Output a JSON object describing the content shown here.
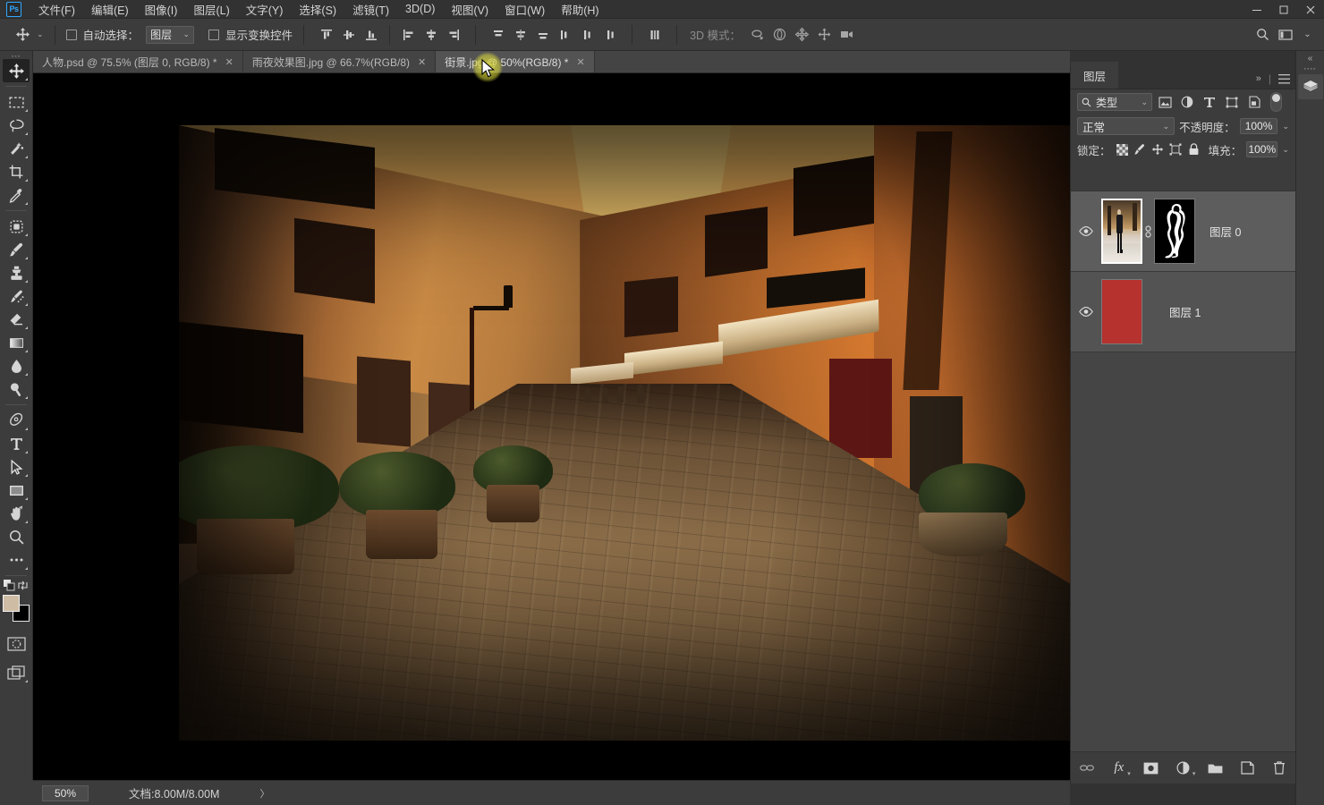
{
  "app": {
    "name": "Photoshop",
    "logo_text": "Ps"
  },
  "menubar": {
    "items": [
      {
        "label": "文件(F)",
        "name": "menu-file"
      },
      {
        "label": "编辑(E)",
        "name": "menu-edit"
      },
      {
        "label": "图像(I)",
        "name": "menu-image"
      },
      {
        "label": "图层(L)",
        "name": "menu-layer"
      },
      {
        "label": "文字(Y)",
        "name": "menu-type"
      },
      {
        "label": "选择(S)",
        "name": "menu-select"
      },
      {
        "label": "滤镜(T)",
        "name": "menu-filter"
      },
      {
        "label": "3D(D)",
        "name": "menu-3d"
      },
      {
        "label": "视图(V)",
        "name": "menu-view"
      },
      {
        "label": "窗口(W)",
        "name": "menu-window"
      },
      {
        "label": "帮助(H)",
        "name": "menu-help"
      }
    ],
    "window_controls": {
      "minimize": "—",
      "maximize": "❐",
      "close": "✕"
    }
  },
  "options_bar": {
    "tool_icon": "move-tool-icon",
    "auto_select_label": "自动选择：",
    "auto_select_checked": false,
    "layer_dropdown_value": "图层",
    "show_transform_label": "显示变换控件",
    "show_transform_checked": false,
    "threed_mode_label": "3D 模式：",
    "align_icons": [
      "align-top-edges-icon",
      "align-vertical-centers-icon",
      "align-bottom-edges-icon",
      "align-left-edges-icon",
      "align-horizontal-centers-icon",
      "align-right-edges-icon"
    ],
    "distribute_icons": [
      "distribute-top-edges-icon",
      "distribute-vertical-centers-icon",
      "distribute-bottom-edges-icon",
      "distribute-left-edges-icon",
      "distribute-horizontal-centers-icon",
      "distribute-right-edges-icon"
    ],
    "extra_icons": [
      "distribute-spacing-icon"
    ],
    "threed_icons": [
      "3d-orbit-icon",
      "3d-roll-icon",
      "3d-pan-icon",
      "3d-slide-icon",
      "3d-camera-icon"
    ],
    "right_icons": [
      "search-icon",
      "workspace-icon",
      "chevron-down-icon"
    ]
  },
  "tabs": [
    {
      "label": "人物.psd @ 75.5% (图层 0, RGB/8) *",
      "active": false,
      "close": "✕"
    },
    {
      "label": "雨夜效果图.jpg @ 66.7%(RGB/8)",
      "active": false,
      "close": "✕"
    },
    {
      "label": "街景.jpg @ 50%(RGB/8) *",
      "active": true,
      "close": "✕"
    }
  ],
  "toolbar": {
    "tools": [
      {
        "name": "move-tool",
        "icon": "move-icon",
        "active": true,
        "submenu": true
      },
      {
        "name": "rectangular-marquee-tool",
        "icon": "marquee-icon",
        "active": false,
        "submenu": true
      },
      {
        "name": "lasso-tool",
        "icon": "lasso-icon",
        "active": false,
        "submenu": true
      },
      {
        "name": "quick-selection-tool",
        "icon": "magic-wand-icon",
        "active": false,
        "submenu": true
      },
      {
        "name": "crop-tool",
        "icon": "crop-icon",
        "active": false,
        "submenu": true
      },
      {
        "name": "eyedropper-tool",
        "icon": "eyedropper-icon",
        "active": false,
        "submenu": true
      },
      {
        "name": "spot-healing-tool",
        "icon": "healing-icon",
        "active": false,
        "submenu": true
      },
      {
        "name": "brush-tool",
        "icon": "brush-icon",
        "active": false,
        "submenu": true
      },
      {
        "name": "clone-stamp-tool",
        "icon": "stamp-icon",
        "active": false,
        "submenu": true
      },
      {
        "name": "history-brush-tool",
        "icon": "history-brush-icon",
        "active": false,
        "submenu": true
      },
      {
        "name": "eraser-tool",
        "icon": "eraser-icon",
        "active": false,
        "submenu": true
      },
      {
        "name": "gradient-tool",
        "icon": "gradient-icon",
        "active": false,
        "submenu": true
      },
      {
        "name": "blur-tool",
        "icon": "blur-drop-icon",
        "active": false,
        "submenu": true
      },
      {
        "name": "dodge-tool",
        "icon": "dodge-icon",
        "active": false,
        "submenu": true
      },
      {
        "name": "pen-tool",
        "icon": "pen-icon",
        "active": false,
        "submenu": true
      },
      {
        "name": "type-tool",
        "icon": "type-t-icon",
        "active": false,
        "submenu": true
      },
      {
        "name": "path-selection-tool",
        "icon": "path-arrow-icon",
        "active": false,
        "submenu": true
      },
      {
        "name": "rectangle-tool",
        "icon": "rectangle-icon",
        "active": false,
        "submenu": true
      },
      {
        "name": "hand-tool",
        "icon": "hand-icon",
        "active": false,
        "submenu": true
      },
      {
        "name": "zoom-tool",
        "icon": "zoom-magnifier-icon",
        "active": false,
        "submenu": false
      },
      {
        "name": "edit-toolbar",
        "icon": "ellipsis-icon",
        "active": false,
        "submenu": true
      }
    ],
    "foreground_color": "#cfbca4",
    "background_color": "#000000",
    "default-colors-icon": "default-colors-icon",
    "swap-colors-icon": "swap-colors-icon",
    "quick-mask-icon": "quick-mask-icon",
    "screen-mode-icon": "screen-mode-icon"
  },
  "layers_panel": {
    "tab_label": "图层",
    "collapse_icon": "chevron-double-right-icon",
    "menu_icon": "hamburger-menu-icon",
    "filter": {
      "search_icon": "search-icon",
      "type_label": "类型",
      "chevron": "⌄",
      "icons": [
        "filter-pixel-icon",
        "filter-adjustment-icon",
        "filter-type-icon",
        "filter-shape-icon",
        "filter-smart-object-icon"
      ],
      "toggle": "filter-enable-toggle"
    },
    "blend_mode": "正常",
    "opacity_label": "不透明度：",
    "opacity_value": "100%",
    "lock_label": "锁定：",
    "lock_icons": [
      "lock-transparent-pixels-icon",
      "lock-image-pixels-icon",
      "lock-position-icon",
      "lock-artboard-icon",
      "lock-all-icon"
    ],
    "fill_label": "填充：",
    "fill_value": "100%",
    "layers": [
      {
        "name": "图层 0",
        "visible": true,
        "selected": true,
        "has_mask": true,
        "linked": true,
        "thumb_type": "photo-person",
        "mask_type": "person-silhouette",
        "eye_icon": "eye-icon",
        "link_icon": "link-icon"
      },
      {
        "name": "图层 1",
        "visible": true,
        "selected": false,
        "has_mask": false,
        "linked": false,
        "thumb_type": "solid-red",
        "thumb_color": "#b5322f",
        "eye_icon": "eye-icon"
      }
    ],
    "bottom_buttons": [
      {
        "name": "link-layers-button",
        "icon": "link-icon"
      },
      {
        "name": "layer-style-button",
        "icon": "fx-icon"
      },
      {
        "name": "add-layer-mask-button",
        "icon": "mask-icon"
      },
      {
        "name": "new-adjustment-layer-button",
        "icon": "half-circle-icon"
      },
      {
        "name": "new-group-button",
        "icon": "folder-icon"
      },
      {
        "name": "new-layer-button",
        "icon": "new-layer-icon"
      },
      {
        "name": "delete-layer-button",
        "icon": "trash-icon"
      }
    ]
  },
  "dock": {
    "collapse_icon": "chevron-double-left-icon",
    "buttons": [
      {
        "name": "layers-dock-button",
        "icon": "layers-stack-icon"
      }
    ]
  },
  "status_bar": {
    "zoom_value": "50%",
    "doc_info": "文档:8.00M/8.00M",
    "expand_icon": "〉"
  },
  "canvas": {
    "document_name": "街景.jpg",
    "zoom": "50%",
    "color_mode": "RGB/8"
  },
  "colors": {
    "chrome_dark": "#323232",
    "panel_bg": "#3c3c3c",
    "layer_row": "#535353",
    "accent_blue": "#31a8ff",
    "red_layer": "#b5322f",
    "cursor_highlight": "#dedc3c"
  }
}
